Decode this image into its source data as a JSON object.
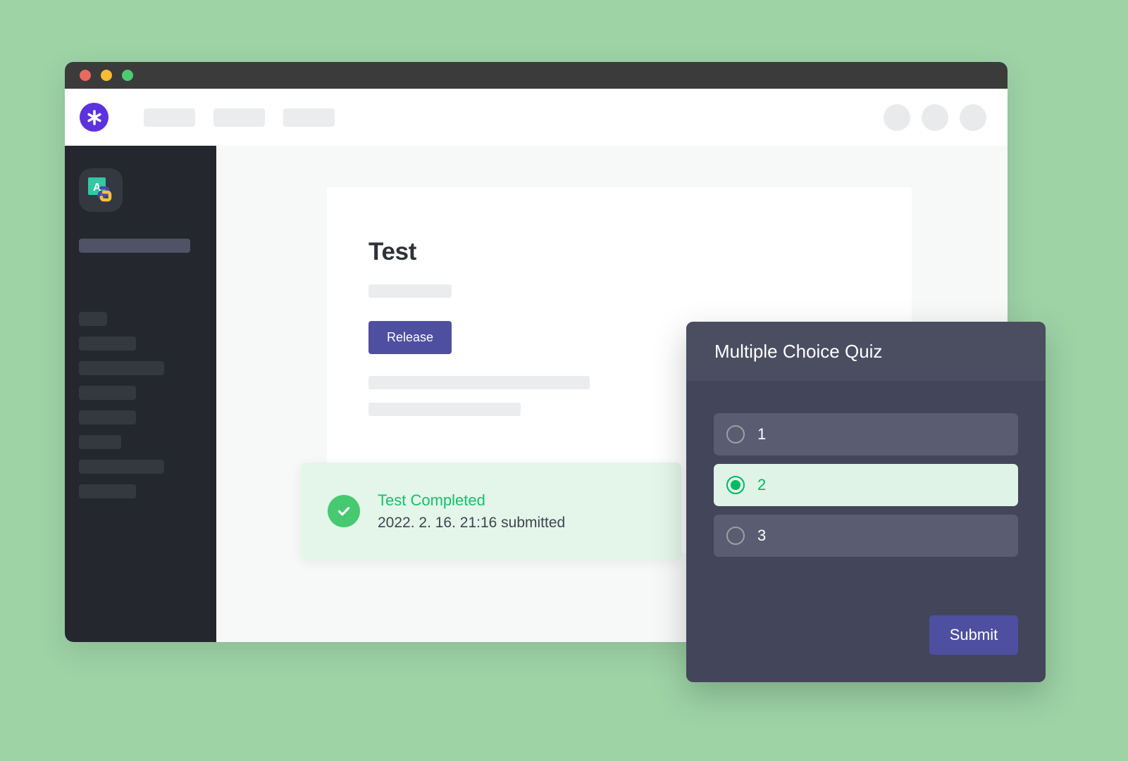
{
  "background_color": "#9ed3a6",
  "window": {
    "titlebar": {
      "buttons": [
        {
          "name": "close",
          "color": "#e96a5e"
        },
        {
          "name": "minimize",
          "color": "#f5bc36"
        },
        {
          "name": "maximize",
          "color": "#4ecb71"
        }
      ]
    },
    "top_nav": {
      "logo_icon": "asterisk-logo-icon",
      "logo_color": "#5b32dd",
      "nav_items": [
        "",
        "",
        ""
      ],
      "avatars": [
        "",
        "",
        ""
      ]
    }
  },
  "sidebar": {
    "background_color": "#24272e",
    "course_icon": "python-course-icon",
    "course_icon_letter": "A",
    "title_placeholder": "",
    "menu_items": [
      "",
      "",
      "",
      "",
      "",
      "",
      "",
      ""
    ]
  },
  "main": {
    "page_title": "Test",
    "subtitle_placeholder": "",
    "release_label": "Release",
    "release_color": "#4e4fa0",
    "body_placeholders": [
      "",
      ""
    ]
  },
  "banner": {
    "status_icon": "check-circle-icon",
    "title": "Test Completed",
    "subtitle": "2022. 2. 16. 21:16 submitted",
    "title_color": "#14c06c",
    "background_color": "#e4f5e9"
  },
  "quiz_modal": {
    "title": "Multiple Choice Quiz",
    "options": [
      {
        "label": "1",
        "selected": false
      },
      {
        "label": "2",
        "selected": true
      },
      {
        "label": "3",
        "selected": false
      }
    ],
    "selected_color": "#00b964",
    "submit_label": "Submit",
    "submit_color": "#4e4fa0"
  }
}
